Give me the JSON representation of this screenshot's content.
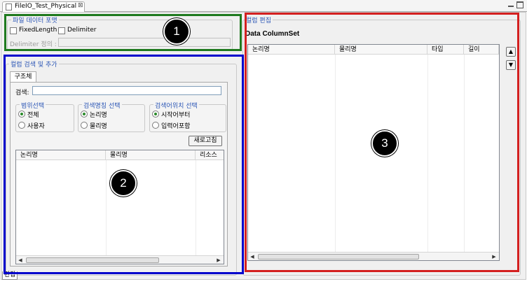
{
  "editor_tab": {
    "title": "FileIO_Test_Physical",
    "close": "⊠"
  },
  "file_format": {
    "title": "파일 데이터 포맷",
    "fixed_length": "FixedLength",
    "delimiter": "Delimiter",
    "delimiter_def": "Delimiter 정의 :"
  },
  "column_search": {
    "title": "컬럼 검색 및 추가",
    "tab": "구조체",
    "search_label": "검색:",
    "scope": {
      "title": "범위선택",
      "options": [
        "전체",
        "사용자"
      ],
      "selected": 0
    },
    "name_select": {
      "title": "검색명칭 선택",
      "options": [
        "논리명",
        "물리명"
      ],
      "selected": 0
    },
    "position_select": {
      "title": "검색어위치 선택",
      "options": [
        "시작어부터",
        "입력어포함"
      ],
      "selected": 0
    },
    "refresh": "새로고침",
    "columns": [
      "논리명",
      "물리명",
      "리소스"
    ]
  },
  "column_edit": {
    "title": "컬럼 편집",
    "table_title": "Data ColumnSet",
    "columns": [
      "논리명",
      "물리명",
      "타입",
      "길이"
    ]
  },
  "bottom_tab": "편집",
  "markers": [
    "1",
    "2",
    "3"
  ],
  "colors": {
    "marker1": "#1f7a1f",
    "marker2": "#0000cc",
    "marker3": "#d42020"
  }
}
